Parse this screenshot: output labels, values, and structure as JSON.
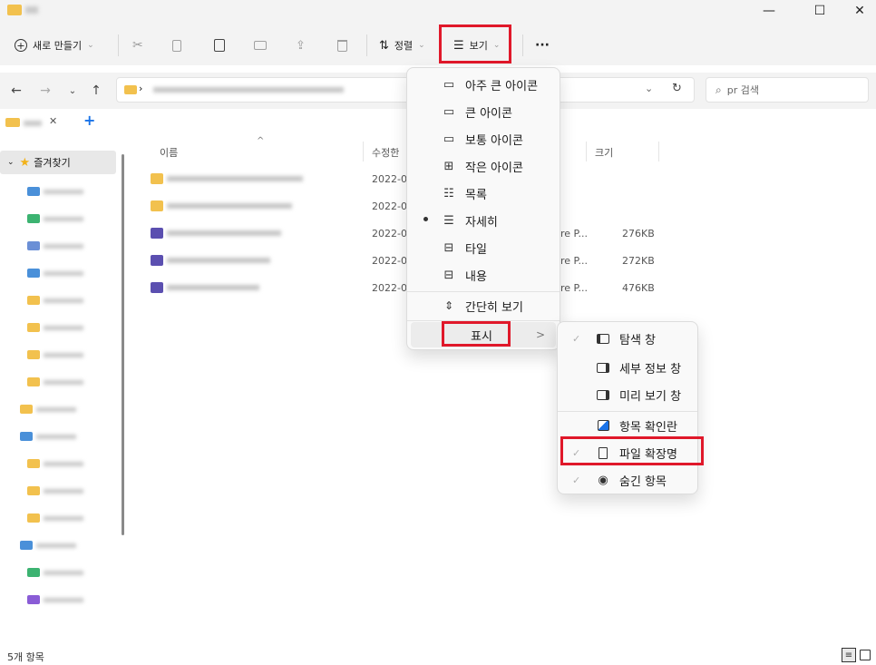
{
  "window": {
    "minimize": "—",
    "maximize": "☐",
    "close": "✕"
  },
  "toolbar": {
    "new_label": "새로 만들기",
    "sort_label": "정렬",
    "view_label": "보기",
    "more_label": "···"
  },
  "address": {
    "search_placeholder": "pr 검색"
  },
  "tabs": {
    "close": "✕",
    "add": "+"
  },
  "sidebar": {
    "favorites_label": "즐겨찾기"
  },
  "columns": {
    "name": "이름",
    "modified": "수정한",
    "size": "크기"
  },
  "files": [
    {
      "date": "2022-0",
      "type": "",
      "size": ""
    },
    {
      "date": "2022-0",
      "type": "",
      "size": ""
    },
    {
      "date": "2022-0",
      "type": "re P...",
      "size": "276KB"
    },
    {
      "date": "2022-0",
      "type": "re P...",
      "size": "272KB"
    },
    {
      "date": "2022-0",
      "type": "re P...",
      "size": "476KB"
    }
  ],
  "view_menu": {
    "items": [
      {
        "label": "아주 큰 아이콘",
        "icon": "monitor-icon"
      },
      {
        "label": "큰 아이콘",
        "icon": "monitor-icon"
      },
      {
        "label": "보통 아이콘",
        "icon": "monitor-icon"
      },
      {
        "label": "작은 아이콘",
        "icon": "grid-icon"
      },
      {
        "label": "목록",
        "icon": "list-icon"
      },
      {
        "label": "자세히",
        "icon": "details-icon",
        "selected": true
      },
      {
        "label": "타일",
        "icon": "tiles-icon"
      },
      {
        "label": "내용",
        "icon": "content-icon"
      }
    ],
    "compact": "간단히 보기",
    "show": "표시",
    "show_arrow": ">"
  },
  "show_menu": {
    "nav_pane": "탐색 창",
    "details_pane": "세부 정보 창",
    "preview_pane": "미리 보기 창",
    "item_checkboxes": "항목 확인란",
    "file_extensions": "파일 확장명",
    "hidden_items": "숨긴 항목"
  },
  "status": {
    "count": "5개 항목"
  },
  "colors": {
    "highlight": "#e0182a",
    "folder": "#f2c14e",
    "accent": "#1a73e8"
  }
}
